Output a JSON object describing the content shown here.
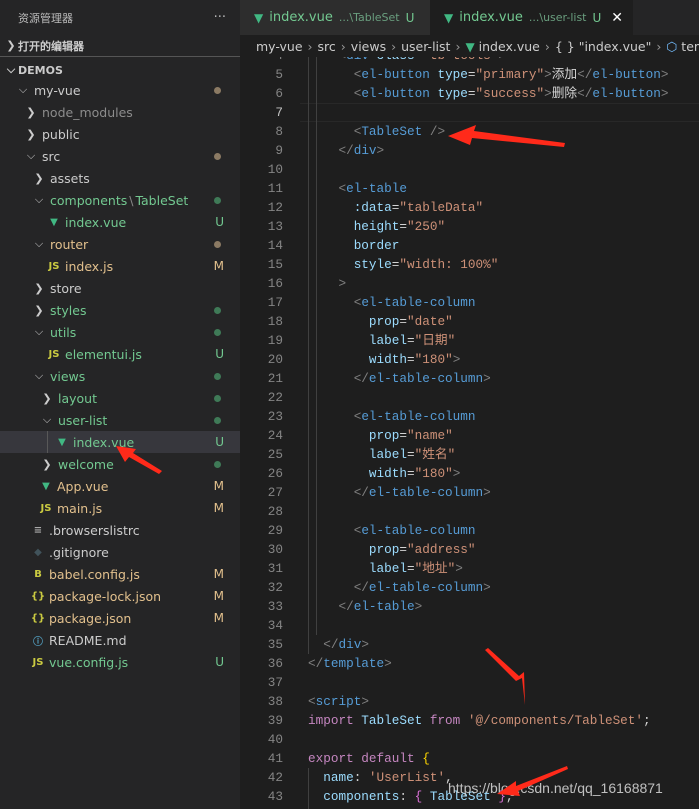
{
  "sidebar": {
    "title": "资源管理器",
    "more": "···",
    "open_editors": "打开的编辑器",
    "workspace": "DEMOS",
    "items": [
      {
        "label": "my-vue",
        "depth": 0,
        "kind": "folder-open",
        "color": "#cccccc",
        "dot": "#8b7a63"
      },
      {
        "label": "node_modules",
        "depth": 1,
        "kind": "folder",
        "color": "#8c8c8c"
      },
      {
        "label": "public",
        "depth": 1,
        "kind": "folder",
        "color": "#cccccc"
      },
      {
        "label": "src",
        "depth": 1,
        "kind": "folder-open",
        "color": "#cccccc",
        "dot": "#8b7a63"
      },
      {
        "label": "assets",
        "depth": 2,
        "kind": "folder",
        "color": "#cccccc"
      },
      {
        "label": "components",
        "label2": "TableSet",
        "depth": 2,
        "kind": "folder-open",
        "color": "#73c991",
        "dot": "#3f7a57"
      },
      {
        "label": "index.vue",
        "depth": 3,
        "kind": "vue",
        "color": "#73c991",
        "badge": "U"
      },
      {
        "label": "router",
        "depth": 2,
        "kind": "folder-open",
        "color": "#e2c08d",
        "dot": "#8b7a63"
      },
      {
        "label": "index.js",
        "depth": 3,
        "kind": "js",
        "color": "#e2c08d",
        "badge": "M"
      },
      {
        "label": "store",
        "depth": 2,
        "kind": "folder",
        "color": "#cccccc"
      },
      {
        "label": "styles",
        "depth": 2,
        "kind": "folder",
        "color": "#73c991",
        "dot": "#3f7a57"
      },
      {
        "label": "utils",
        "depth": 2,
        "kind": "folder-open",
        "color": "#73c991",
        "dot": "#3f7a57"
      },
      {
        "label": "elementui.js",
        "depth": 3,
        "kind": "js",
        "color": "#73c991",
        "badge": "U"
      },
      {
        "label": "views",
        "depth": 2,
        "kind": "folder-open",
        "color": "#73c991",
        "dot": "#3f7a57"
      },
      {
        "label": "layout",
        "depth": 3,
        "kind": "folder",
        "color": "#73c991",
        "dot": "#3f7a57"
      },
      {
        "label": "user-list",
        "depth": 3,
        "kind": "folder-open",
        "color": "#73c991",
        "dot": "#3f7a57"
      },
      {
        "label": "index.vue",
        "depth": 4,
        "kind": "vue",
        "color": "#73c991",
        "badge": "U",
        "selected": true
      },
      {
        "label": "welcome",
        "depth": 3,
        "kind": "folder",
        "color": "#73c991",
        "dot": "#3f7a57"
      },
      {
        "label": "App.vue",
        "depth": 2,
        "kind": "vue",
        "color": "#e2c08d",
        "badge": "M"
      },
      {
        "label": "main.js",
        "depth": 2,
        "kind": "js",
        "color": "#e2c08d",
        "badge": "M"
      },
      {
        "label": ".browserslistrc",
        "depth": 1,
        "kind": "lines",
        "color": "#cccccc"
      },
      {
        "label": ".gitignore",
        "depth": 1,
        "kind": "git",
        "color": "#cccccc"
      },
      {
        "label": "babel.config.js",
        "depth": 1,
        "kind": "babel",
        "color": "#e2c08d",
        "badge": "M"
      },
      {
        "label": "package-lock.json",
        "depth": 1,
        "kind": "json",
        "color": "#e2c08d",
        "badge": "M"
      },
      {
        "label": "package.json",
        "depth": 1,
        "kind": "json",
        "color": "#e2c08d",
        "badge": "M"
      },
      {
        "label": "README.md",
        "depth": 1,
        "kind": "info",
        "color": "#cccccc"
      },
      {
        "label": "vue.config.js",
        "depth": 1,
        "kind": "js",
        "color": "#73c991",
        "badge": "U"
      }
    ]
  },
  "tabs": [
    {
      "label": "index.vue",
      "path": "...\\TableSet",
      "status": "U",
      "active": false
    },
    {
      "label": "index.vue",
      "path": "...\\user-list",
      "status": "U",
      "active": true,
      "close": "✕"
    }
  ],
  "breadcrumb": [
    "my-vue",
    "src",
    "views",
    "user-list",
    "index.vue",
    "{ } \"index.vue\"",
    "templ"
  ],
  "code": {
    "first_line": 4,
    "current_line": 7,
    "lines": [
      [
        [
          "    ",
          "w"
        ],
        [
          "<",
          "g"
        ],
        [
          "div",
          "t"
        ],
        [
          " class",
          "a"
        ],
        [
          "=",
          "w"
        ],
        [
          "\"tb-tools\"",
          "s"
        ],
        [
          ">",
          "g"
        ]
      ],
      [
        [
          "      ",
          "w"
        ],
        [
          "<",
          "g"
        ],
        [
          "el-button",
          "t"
        ],
        [
          " type",
          "a"
        ],
        [
          "=",
          "w"
        ],
        [
          "\"primary\"",
          "s"
        ],
        [
          ">",
          "g"
        ],
        [
          "添加",
          "w"
        ],
        [
          "</",
          "g"
        ],
        [
          "el-button",
          "t"
        ],
        [
          ">",
          "g"
        ]
      ],
      [
        [
          "      ",
          "w"
        ],
        [
          "<",
          "g"
        ],
        [
          "el-button",
          "t"
        ],
        [
          " type",
          "a"
        ],
        [
          "=",
          "w"
        ],
        [
          "\"success\"",
          "s"
        ],
        [
          ">",
          "g"
        ],
        [
          "删除",
          "w"
        ],
        [
          "</",
          "g"
        ],
        [
          "el-button",
          "t"
        ],
        [
          ">",
          "g"
        ]
      ],
      [],
      [
        [
          "      ",
          "w"
        ],
        [
          "<",
          "g"
        ],
        [
          "TableSet",
          "t"
        ],
        [
          " />",
          "g"
        ]
      ],
      [
        [
          "    ",
          "w"
        ],
        [
          "</",
          "g"
        ],
        [
          "div",
          "t"
        ],
        [
          ">",
          "g"
        ]
      ],
      [],
      [
        [
          "    ",
          "w"
        ],
        [
          "<",
          "g"
        ],
        [
          "el-table",
          "t"
        ]
      ],
      [
        [
          "      ",
          "w"
        ],
        [
          ":data",
          "a"
        ],
        [
          "=",
          "w"
        ],
        [
          "\"tableData\"",
          "s"
        ]
      ],
      [
        [
          "      ",
          "w"
        ],
        [
          "height",
          "a"
        ],
        [
          "=",
          "w"
        ],
        [
          "\"250\"",
          "s"
        ]
      ],
      [
        [
          "      ",
          "w"
        ],
        [
          "border",
          "a"
        ]
      ],
      [
        [
          "      ",
          "w"
        ],
        [
          "style",
          "a"
        ],
        [
          "=",
          "w"
        ],
        [
          "\"width: 100%\"",
          "s"
        ]
      ],
      [
        [
          "    ",
          "w"
        ],
        [
          ">",
          "g"
        ]
      ],
      [
        [
          "      ",
          "w"
        ],
        [
          "<",
          "g"
        ],
        [
          "el-table-column",
          "t"
        ]
      ],
      [
        [
          "        ",
          "w"
        ],
        [
          "prop",
          "a"
        ],
        [
          "=",
          "w"
        ],
        [
          "\"date\"",
          "s"
        ]
      ],
      [
        [
          "        ",
          "w"
        ],
        [
          "label",
          "a"
        ],
        [
          "=",
          "w"
        ],
        [
          "\"日期\"",
          "s"
        ]
      ],
      [
        [
          "        ",
          "w"
        ],
        [
          "width",
          "a"
        ],
        [
          "=",
          "w"
        ],
        [
          "\"180\"",
          "s"
        ],
        [
          ">",
          "g"
        ]
      ],
      [
        [
          "      ",
          "w"
        ],
        [
          "</",
          "g"
        ],
        [
          "el-table-column",
          "t"
        ],
        [
          ">",
          "g"
        ]
      ],
      [],
      [
        [
          "      ",
          "w"
        ],
        [
          "<",
          "g"
        ],
        [
          "el-table-column",
          "t"
        ]
      ],
      [
        [
          "        ",
          "w"
        ],
        [
          "prop",
          "a"
        ],
        [
          "=",
          "w"
        ],
        [
          "\"name\"",
          "s"
        ]
      ],
      [
        [
          "        ",
          "w"
        ],
        [
          "label",
          "a"
        ],
        [
          "=",
          "w"
        ],
        [
          "\"姓名\"",
          "s"
        ]
      ],
      [
        [
          "        ",
          "w"
        ],
        [
          "width",
          "a"
        ],
        [
          "=",
          "w"
        ],
        [
          "\"180\"",
          "s"
        ],
        [
          ">",
          "g"
        ]
      ],
      [
        [
          "      ",
          "w"
        ],
        [
          "</",
          "g"
        ],
        [
          "el-table-column",
          "t"
        ],
        [
          ">",
          "g"
        ]
      ],
      [],
      [
        [
          "      ",
          "w"
        ],
        [
          "<",
          "g"
        ],
        [
          "el-table-column",
          "t"
        ]
      ],
      [
        [
          "        ",
          "w"
        ],
        [
          "prop",
          "a"
        ],
        [
          "=",
          "w"
        ],
        [
          "\"address\"",
          "s"
        ]
      ],
      [
        [
          "        ",
          "w"
        ],
        [
          "label",
          "a"
        ],
        [
          "=",
          "w"
        ],
        [
          "\"地址\"",
          "s"
        ],
        [
          ">",
          "g"
        ]
      ],
      [
        [
          "      ",
          "w"
        ],
        [
          "</",
          "g"
        ],
        [
          "el-table-column",
          "t"
        ],
        [
          ">",
          "g"
        ]
      ],
      [
        [
          "    ",
          "w"
        ],
        [
          "</",
          "g"
        ],
        [
          "el-table",
          "t"
        ],
        [
          ">",
          "g"
        ]
      ],
      [],
      [
        [
          "  ",
          "w"
        ],
        [
          "</",
          "g"
        ],
        [
          "div",
          "t"
        ],
        [
          ">",
          "g"
        ]
      ],
      [
        [
          "</",
          "g"
        ],
        [
          "template",
          "t"
        ],
        [
          ">",
          "g"
        ]
      ],
      [],
      [
        [
          "<",
          "g"
        ],
        [
          "script",
          "t"
        ],
        [
          ">",
          "g"
        ]
      ],
      [
        [
          "import",
          "k"
        ],
        [
          " TableSet ",
          "v"
        ],
        [
          "from",
          "k"
        ],
        [
          " '@/components/TableSet'",
          "s"
        ],
        [
          ";",
          "w"
        ]
      ],
      [],
      [
        [
          "export",
          "k"
        ],
        [
          " default ",
          "k"
        ],
        [
          "{",
          "y"
        ]
      ],
      [
        [
          "  name",
          "v"
        ],
        [
          ": ",
          "w"
        ],
        [
          "'UserList'",
          "s"
        ],
        [
          ",",
          "w"
        ]
      ],
      [
        [
          "  components",
          "v"
        ],
        [
          ": ",
          "w"
        ],
        [
          "{",
          "p"
        ],
        [
          " TableSet ",
          "v"
        ],
        [
          "}",
          "p"
        ],
        [
          ",",
          "w"
        ]
      ]
    ]
  },
  "watermark": "https://blog.csdn.net/qq_16168871",
  "colors": {
    "annotation_arrow": "#ff2a1a",
    "accent_untracked": "#73c991",
    "accent_modified": "#e2c08d"
  }
}
